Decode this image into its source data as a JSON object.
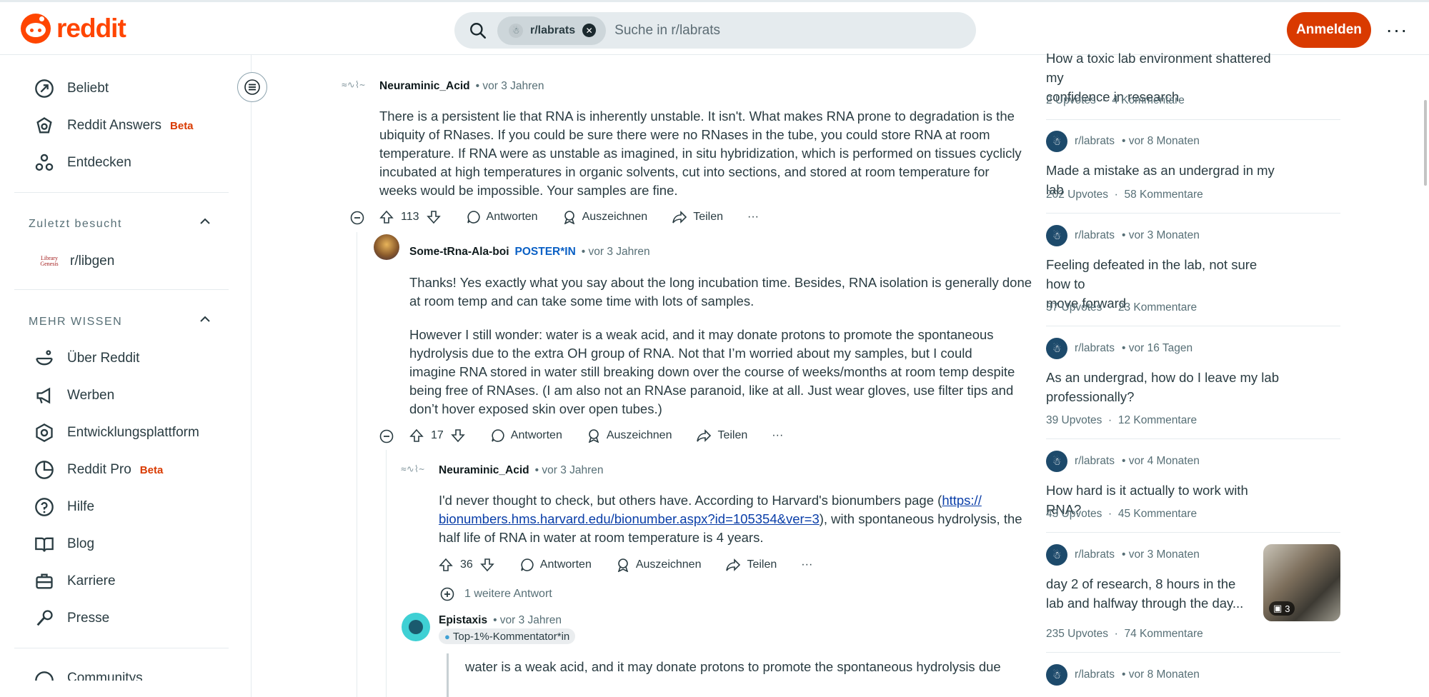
{
  "header": {
    "logo_text": "reddit",
    "search_chip": "r/labrats",
    "search_placeholder": "Suche in r/labrats",
    "login_label": "Anmelden",
    "more_label": "···"
  },
  "sidebar": {
    "top_items": [
      {
        "label": "Beliebt",
        "icon": "trending-icon"
      },
      {
        "label": "Reddit Answers",
        "badge": "Beta",
        "icon": "answers-icon"
      },
      {
        "label": "Entdecken",
        "icon": "explore-icon"
      }
    ],
    "recent_heading": "Zuletzt besucht",
    "recent_items": [
      {
        "label": "r/libgen",
        "icon_text": "Library Genesis"
      }
    ],
    "more_heading": "MEHR WISSEN",
    "more_items": [
      {
        "label": "Über Reddit"
      },
      {
        "label": "Werben"
      },
      {
        "label": "Entwicklungsplattform"
      },
      {
        "label": "Reddit Pro",
        "badge": "Beta"
      },
      {
        "label": "Hilfe"
      },
      {
        "label": "Blog"
      },
      {
        "label": "Karriere"
      },
      {
        "label": "Presse"
      }
    ],
    "cut_item": "Communitys"
  },
  "comments": [
    {
      "author": "Neuraminic_Acid",
      "time": "• vor 3 Jahren",
      "lines": [
        "There is a persistent lie that RNA is inherently unstable. It isn't. What makes RNA prone to degradation is the",
        "ubiquity of RNases. If you could be sure there were no RNases in the tube, you could store RNA at room",
        "temperature. If RNA were as unstable as imagined, in situ hybridization, which is performed on tissues cyclicly",
        "incubated at high temperatures in organic solvents, cut into sections, and stored at room temperature for",
        "weeks would be impossible. Your samples are fine."
      ],
      "votes": "113"
    },
    {
      "author": "Some-tRna-Ala-boi",
      "poster_tag": "POSTER*IN",
      "time": "• vor 3 Jahren",
      "para1": [
        "Thanks! Yes exactly what you say about the long incubation time. Besides, RNA isolation is generally done",
        "at room temp and can take some time with lots of samples."
      ],
      "para2": [
        "However I still wonder: water is a weak acid, and it may donate protons to promote the spontaneous",
        "hydrolysis due to the extra OH group of RNA. Not that I’m worried about my samples, but I could",
        "imagine RNA stored in water still breaking down over the course of weeks/months at room temp despite",
        "being free of RNAses. (I am also not an RNAse paranoid, like at all. Just wear gloves, use filter tips and",
        "don’t hover exposed skin over open tubes.)"
      ],
      "votes": "17"
    },
    {
      "author": "Neuraminic_Acid",
      "time": "• vor 3 Jahren",
      "line1_pre": "I'd never thought to check, but others have. According to Harvard's bionumbers page (",
      "line1_link": "https://",
      "line2_link": "bionumbers.hms.harvard.edu/bionumber.aspx?id=105354&ver=3",
      "line2_post": "), with spontaneous hydrolysis, the",
      "line3": "half life of RNA in water at room temperature is 4 years.",
      "votes": "36",
      "more_replies": "1 weitere Antwort"
    },
    {
      "author": "Epistaxis",
      "time": "• vor 3 Jahren",
      "flair": "Top-1%-Kommentator*in",
      "quote": "water is a weak acid, and it may donate protons to promote the spontaneous hydrolysis due"
    }
  ],
  "actions": {
    "reply": "Antworten",
    "award": "Auszeichnen",
    "share": "Teilen",
    "more": "···"
  },
  "rail": [
    {
      "sub": "",
      "time": "",
      "title_lines": [
        "How a toxic lab environment shattered my",
        "confidence in research"
      ],
      "upvotes": "2 Upvotes",
      "comments": "4 Kommentare"
    },
    {
      "sub": "r/labrats",
      "time": "• vor 8 Monaten",
      "title_lines": [
        "Made a mistake as an undergrad in my lab"
      ],
      "upvotes": "202 Upvotes",
      "comments": "58 Kommentare"
    },
    {
      "sub": "r/labrats",
      "time": "• vor 3 Monaten",
      "title_lines": [
        "Feeling defeated in the lab, not sure how to",
        "move forward"
      ],
      "upvotes": "37 Upvotes",
      "comments": "23 Kommentare"
    },
    {
      "sub": "r/labrats",
      "time": "• vor 16 Tagen",
      "title_lines": [
        "As an undergrad, how do I leave my lab",
        "professionally?"
      ],
      "upvotes": "39 Upvotes",
      "comments": "12 Kommentare"
    },
    {
      "sub": "r/labrats",
      "time": "• vor 4 Monaten",
      "title_lines": [
        "How hard is it actually to work with RNA?"
      ],
      "upvotes": "43 Upvotes",
      "comments": "45 Kommentare"
    },
    {
      "sub": "r/labrats",
      "time": "• vor 3 Monaten",
      "title_lines": [
        "day 2 of research, 8 hours in the",
        "lab and halfway through the day..."
      ],
      "upvotes": "235 Upvotes",
      "comments": "74 Kommentare",
      "thumb_count": "3"
    },
    {
      "sub": "r/labrats",
      "time": "• vor 8 Monaten"
    }
  ],
  "rail_separator": "·",
  "colors": {
    "brand": "#ff4500",
    "login": "#d93a00",
    "link": "#0a3ea8",
    "poster": "#0a60c5"
  }
}
